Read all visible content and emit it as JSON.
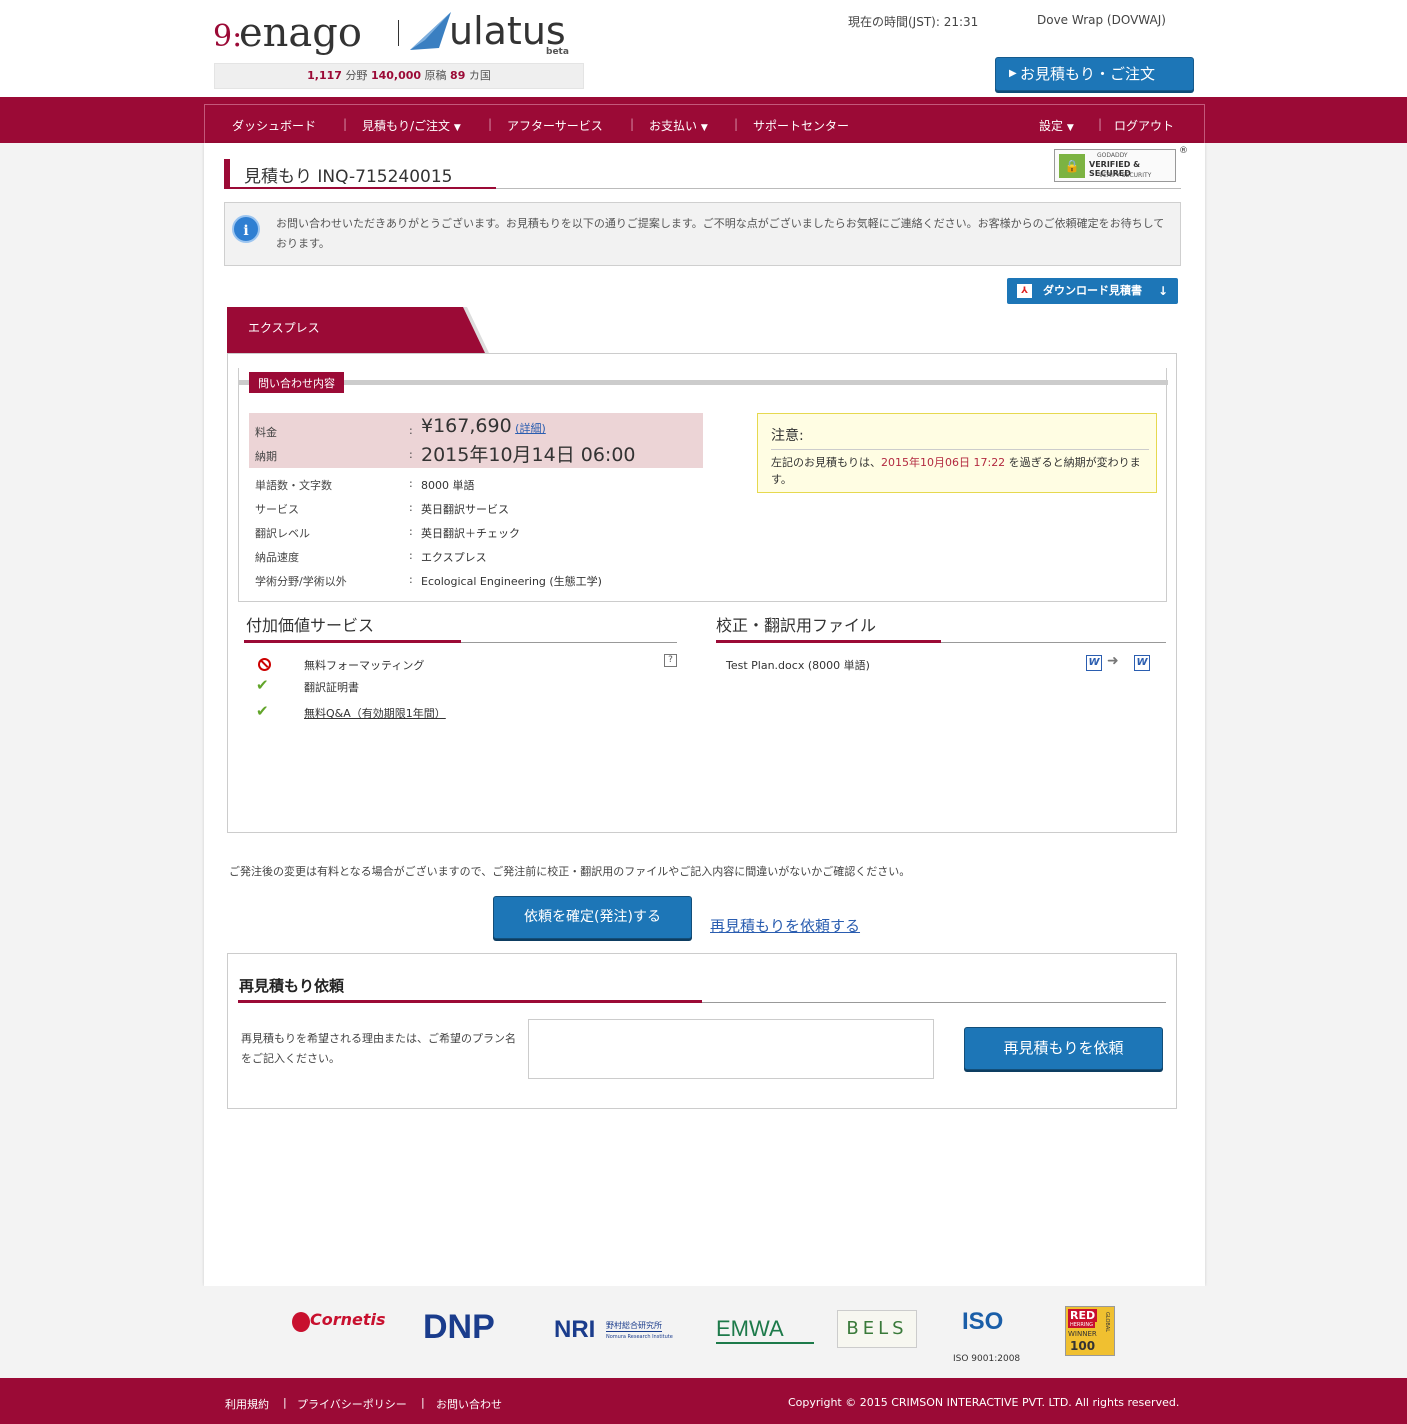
{
  "header": {
    "logo_enago": "enago",
    "logo_ulatus": "ulatus",
    "logo_beta": "beta",
    "stats": {
      "fields": "1,117",
      "fields_unit": "分野",
      "manuscripts": "140,000",
      "manuscripts_unit": "原稿",
      "countries": "89",
      "countries_unit": "カ国"
    },
    "time": "現在の時間(JST): 21:31",
    "user": "Dove Wrap (DOVWAJ)",
    "order_button": "お見積もり・ご注文"
  },
  "nav": {
    "dashboard": "ダッシュボード",
    "quote_order": "見積もり/ご注文",
    "after_service": "アフターサービス",
    "payment": "お支払い",
    "support": "サポートセンター",
    "settings": "設定",
    "logout": "ログアウト"
  },
  "page": {
    "title": "見積もり INQ-715240015",
    "badge": {
      "line1": "GODADDY",
      "line2": "VERIFIED & SECURED",
      "line3": "VERIFY SECURITY"
    },
    "info_text": "お問い合わせいただきありがとうございます。お見積もりを以下の通りご提案します。ご不明な点がございましたらお気軽にご連絡ください。お客様からのご依頼確定をお待ちしております。",
    "download_button": "ダウンロード見積書",
    "tab_label": "エクスプレス",
    "inquiry_label": "問い合わせ内容",
    "fee_label": "料金",
    "fee_value": "¥167,690",
    "fee_detail_link": "(詳細)",
    "delivery_label": "納期",
    "delivery_value": "2015年10月14日 06:00",
    "details": [
      {
        "label": "単語数・文字数",
        "value": "8000 単語"
      },
      {
        "label": "サービス",
        "value": "英日翻訳サービス"
      },
      {
        "label": "翻訳レベル",
        "value": "英日翻訳＋チェック"
      },
      {
        "label": "納品速度",
        "value": "エクスプレス"
      },
      {
        "label": "学術分野/学術以外",
        "value": "Ecological Engineering (生態工学)"
      }
    ],
    "note_title": "注意:",
    "note_text_before": "左記のお見積もりは、",
    "note_date": "2015年10月06日 17:22",
    "note_text_after": " を過ぎると納期が変わります。",
    "addon_title": "付加価値サービス",
    "addons": [
      {
        "label": "無料フォーマッティング",
        "status": "excluded"
      },
      {
        "label": "翻訳証明書",
        "status": "included"
      },
      {
        "label": "無料Q&A（有効期限1年間）",
        "status": "included",
        "link": true
      }
    ],
    "help_icon": "?",
    "files_title": "校正・翻訳用ファイル",
    "file_name": "Test Plan.docx (8000 単語)",
    "warning": "ご発注後の変更は有料となる場合がございますので、ご発注前に校正・翻訳用のファイルやご記入内容に間違いがないかご確認ください。",
    "confirm_button": "依頼を確定(発注)する",
    "requote_link": "再見積もりを依頼する",
    "requote_title": "再見積もり依頼",
    "requote_label": "再見積もりを希望される理由または、ご希望のプラン名をご記入ください。",
    "requote_button": "再見積もりを依頼"
  },
  "clients": {
    "cornetis": "Cornetis",
    "dnp": "DNP",
    "nri": "NRI",
    "nri_sub": "野村総合研究所",
    "nri_sub2": "Nomura Research Institute",
    "emwa": "EMWA",
    "bels": "BELS",
    "iso": "ISO",
    "iso_sub": "ISO 9001:2008",
    "red": "RED",
    "herring": "HERRING",
    "winner": "WINNER",
    "hundred": "100",
    "global": "GLOBAL"
  },
  "footer": {
    "terms": "利用規約",
    "privacy": "プライバシーポリシー",
    "contact": "お問い合わせ",
    "copyright": "Copyright © 2015 CRIMSON INTERACTIVE PVT. LTD. All rights reserved."
  },
  "colors": {
    "brand": "#9b0a36",
    "button": "#1d76b7"
  }
}
